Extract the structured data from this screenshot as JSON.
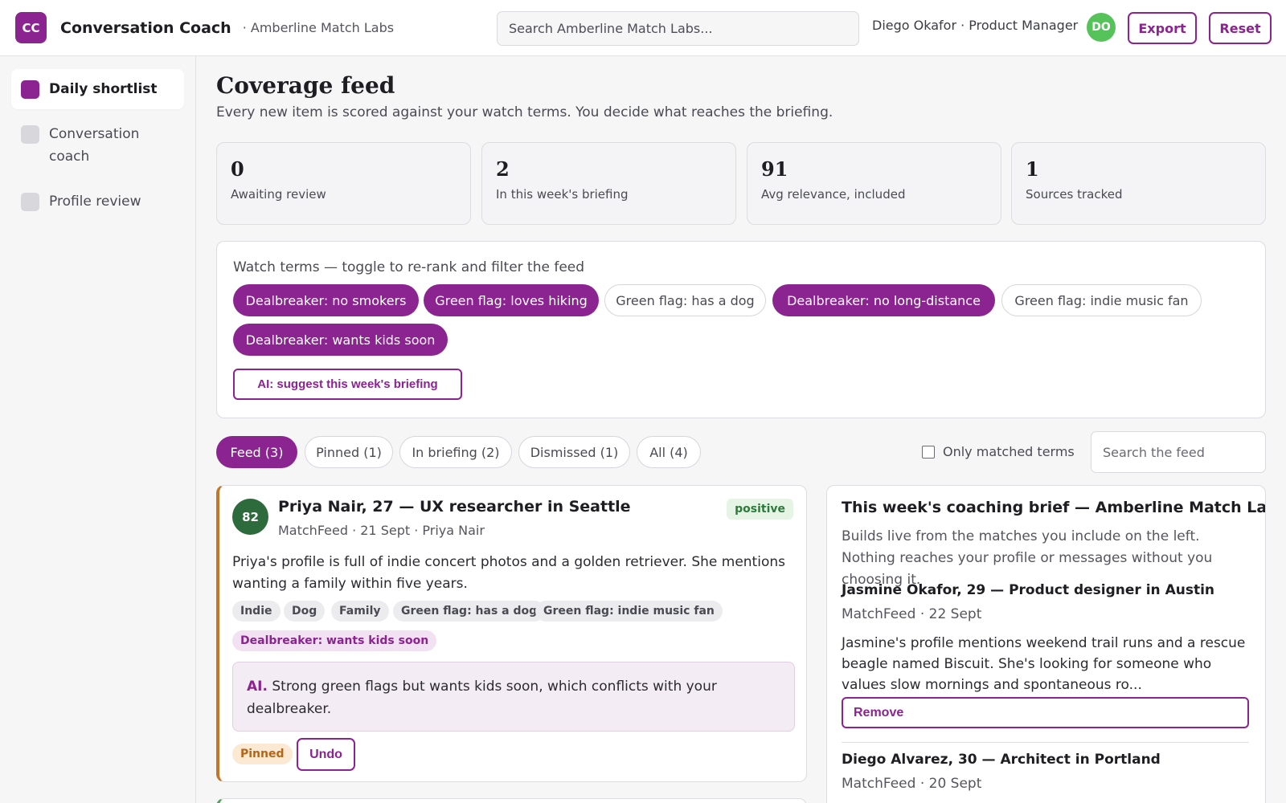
{
  "header": {
    "logo": "CC",
    "app_title": "Conversation Coach",
    "org": "· Amberline Match Labs",
    "search_placeholder": "Search Amberline Match Labs...",
    "user": "Diego Okafor · Product Manager",
    "avatar": "DO",
    "export_label": "Export",
    "reset_label": "Reset"
  },
  "sidebar": {
    "items": [
      {
        "label": "Daily shortlist",
        "active": true
      },
      {
        "label": "Conversation coach",
        "active": false
      },
      {
        "label": "Profile review",
        "active": false
      }
    ]
  },
  "page": {
    "title": "Coverage feed",
    "subtitle": "Every new item is scored against your watch terms. You decide what reaches the briefing."
  },
  "stats": [
    {
      "value": "0",
      "label": "Awaiting review"
    },
    {
      "value": "2",
      "label": "In this week's briefing"
    },
    {
      "value": "91",
      "label": "Avg relevance, included"
    },
    {
      "value": "1",
      "label": "Sources tracked"
    }
  ],
  "watch_terms": {
    "label": "Watch terms — toggle to re-rank and filter the feed",
    "terms": [
      {
        "label": "Dealbreaker: no smokers",
        "on": true
      },
      {
        "label": "Green flag: loves hiking",
        "on": true
      },
      {
        "label": "Green flag: has a dog",
        "on": false
      },
      {
        "label": "Dealbreaker: no long-distance",
        "on": true
      },
      {
        "label": "Green flag: indie music fan",
        "on": false
      },
      {
        "label": "Dealbreaker: wants kids soon",
        "on": true
      }
    ],
    "ai_button": "AI: suggest this week's briefing"
  },
  "tabs": [
    {
      "label": "Feed (3)",
      "active": true
    },
    {
      "label": "Pinned (1)",
      "active": false
    },
    {
      "label": "In briefing (2)",
      "active": false
    },
    {
      "label": "Dismissed (1)",
      "active": false
    },
    {
      "label": "All (4)",
      "active": false
    }
  ],
  "filter": {
    "only_matched_label": "Only matched terms",
    "only_matched_checked": false,
    "search_placeholder": "Search the feed"
  },
  "feed_card": {
    "score": "82",
    "title": "Priya Nair, 27 — UX researcher in Seattle",
    "meta": "MatchFeed · 21 Sept · Priya Nair",
    "sentiment": "positive",
    "body": "Priya's profile is full of indie concert photos and a golden retriever. She mentions wanting a family within five years.",
    "tags": [
      "Indie",
      "Dog",
      "Family",
      "Green flag: has a dog",
      "Green flag: indie music fan"
    ],
    "flag_tag": "Dealbreaker: wants kids soon",
    "ai_prefix": "AI.",
    "ai_note": "Strong green flags but wants kids soon, which conflicts with your dealbreaker.",
    "status": "Pinned",
    "undo_label": "Undo"
  },
  "brief": {
    "title": "This week's coaching brief — Amberline Match Labs",
    "subtitle": "Builds live from the matches you include on the left. Nothing reaches your profile or messages without you choosing it.",
    "items": [
      {
        "title": "Jasmine Okafor, 29 — Product designer in Austin",
        "meta": "MatchFeed · 22 Sept",
        "body": "Jasmine's profile mentions weekend trail runs and a rescue beagle named Biscuit. She's looking for someone who values slow mornings and spontaneous ro...",
        "remove_label": "Remove"
      },
      {
        "title": "Diego Alvarez, 30 — Architect in Portland",
        "meta": "MatchFeed · 20 Sept"
      }
    ]
  },
  "colors": {
    "accent": "#8b2391",
    "positive": "#2d7a3a",
    "pinned": "#b3661a",
    "avatar": "#56c25a"
  }
}
